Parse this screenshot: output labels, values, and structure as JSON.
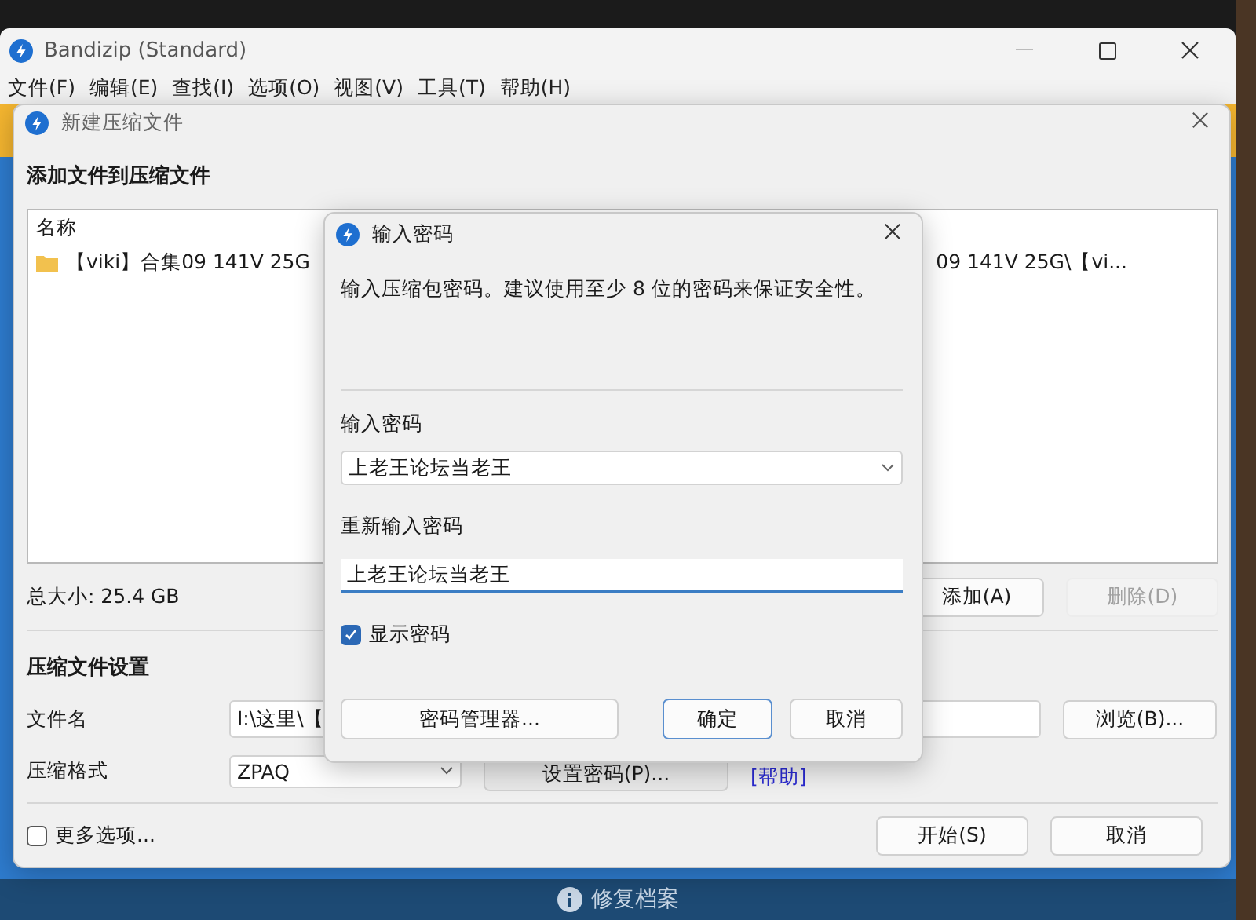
{
  "main_window": {
    "title": "Bandizip (Standard)",
    "menu": [
      "文件(F)",
      "编辑(E)",
      "查找(I)",
      "选项(O)",
      "视图(V)",
      "工具(T)",
      "帮助(H)"
    ]
  },
  "archive_dialog": {
    "title": "新建压缩文件",
    "heading": "添加文件到压缩文件",
    "file_list": {
      "column": "名称",
      "rows": [
        {
          "name": "【viki】合集09 141V 25G",
          "column_2": "09 141V 25G\\【vi..."
        }
      ]
    },
    "total_size": "总大小: 25.4 GB",
    "list_buttons": [
      {
        "label": "添加(A)",
        "disabled": false
      },
      {
        "label": "删除(D)",
        "disabled": true
      }
    ],
    "settings_heading": "压缩文件设置",
    "file_name": {
      "label": "文件名",
      "value": "I:\\这里\\【",
      "browse": "浏览(B)..."
    },
    "format": {
      "label": "压缩格式",
      "value": "ZPAQ",
      "set_password": "设置密码(P)...",
      "help": "[帮助]"
    },
    "more_options": {
      "label": "更多选项...",
      "checked": false
    },
    "buttons": [
      {
        "label": "开始(S)"
      },
      {
        "label": "取消"
      }
    ]
  },
  "password_dialog": {
    "title": "输入密码",
    "description": "输入压缩包密码。建议使用至少 8 位的密码来保证安全性。",
    "password": {
      "label": "输入密码",
      "value": "上老王论坛当老王"
    },
    "confirm": {
      "label": "重新输入密码",
      "value": "上老王论坛当老王",
      "focused": true
    },
    "show_password": {
      "label": "显示密码",
      "checked": true
    },
    "manager_button": "密码管理器...",
    "buttons": [
      {
        "label": "确定",
        "default": true
      },
      {
        "label": "取消",
        "default": false
      }
    ]
  },
  "status_bar": {
    "text": "修复档案"
  }
}
